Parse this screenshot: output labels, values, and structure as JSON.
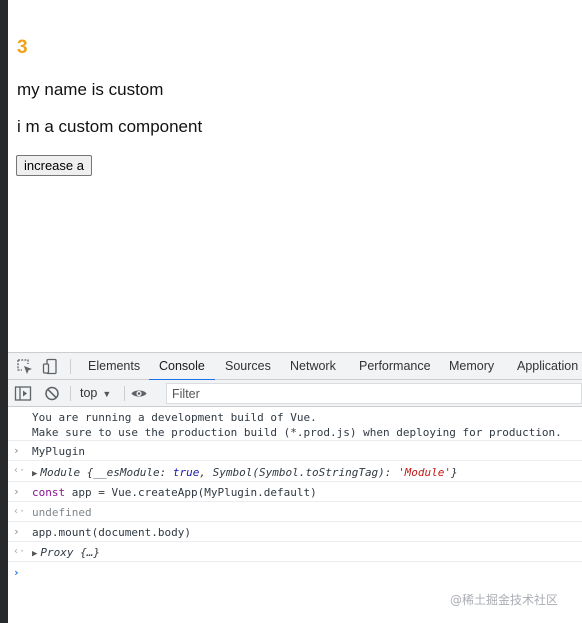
{
  "app": {
    "count": "3",
    "name_line": "my name is custom",
    "component_line": "i m a custom component",
    "increase_button": "increase a"
  },
  "devtools": {
    "tabs": [
      {
        "label": "Elements"
      },
      {
        "label": "Console",
        "active": true
      },
      {
        "label": "Sources"
      },
      {
        "label": "Network"
      },
      {
        "label": "Performance"
      },
      {
        "label": "Memory"
      },
      {
        "label": "Application"
      }
    ],
    "toolbar": {
      "context": "top",
      "filter_placeholder": "Filter"
    },
    "console": {
      "warning_line1": "You are running a development build of Vue.",
      "warning_line2": "Make sure to use the production build (*.prod.js) when deploying for production.",
      "input1": "MyPlugin",
      "output1": {
        "prefix": "Module {__esModule: ",
        "bool": "true",
        "middle": ", Symbol(Symbol.toStringTag): ",
        "str": "'Module'",
        "suffix": "}"
      },
      "input2": {
        "keyword": "const",
        "rest": " app = Vue.createApp(MyPlugin.default)"
      },
      "output2": "undefined",
      "input3": "app.mount(document.body)",
      "output3": "Proxy {…}"
    }
  },
  "watermark": "@稀土掘金技术社区",
  "colors": {
    "count": "#f0a319",
    "accent": "#1a73e8",
    "keyword": "#881391",
    "boolean": "#1a1aa6",
    "string": "#c41a16"
  },
  "icons": [
    "inspect-element-icon",
    "device-toggle-icon",
    "sidebar-toggle-icon",
    "clear-console-icon",
    "eye-icon",
    "input-prompt-icon",
    "output-arrow-icon",
    "expand-triangle-icon"
  ]
}
